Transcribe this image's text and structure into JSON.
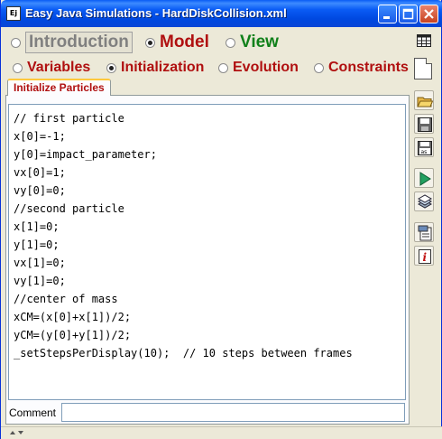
{
  "window": {
    "title": "Easy Java Simulations - HardDiskCollision.xml",
    "app_icon_text": "Ej"
  },
  "main_tabs": [
    {
      "label": "Introduction",
      "selected": false
    },
    {
      "label": "Model",
      "selected": true
    },
    {
      "label": "View",
      "selected": false
    }
  ],
  "model_tabs": [
    {
      "label": "Variables",
      "selected": false
    },
    {
      "label": "Initialization",
      "selected": true
    },
    {
      "label": "Evolution",
      "selected": false
    },
    {
      "label": "Constraints",
      "selected": false
    }
  ],
  "page_tab": {
    "label": "Initialize Particles"
  },
  "editor": {
    "code": "// first particle\nx[0]=-1;\ny[0]=impact_parameter;\nvx[0]=1;\nvy[0]=0;\n//second particle\nx[1]=0;\ny[1]=0;\nvx[1]=0;\nvy[1]=0;\n//center of mass\nxCM=(x[0]+x[1])/2;\nyCM=(y[0]+y[1])/2;\n_setStepsPerDisplay(10);  // 10 steps between frames"
  },
  "comment": {
    "label": "Comment",
    "value": ""
  },
  "toolbar_icons": [
    "open-icon",
    "save-icon",
    "save-as-icon",
    "run-icon",
    "package-icon",
    "properties-icon",
    "info-icon"
  ],
  "colors": {
    "titlebar": "#0a5cf5",
    "model_red": "#b01010",
    "view_green": "#10801a",
    "intro_gray": "#808080"
  }
}
